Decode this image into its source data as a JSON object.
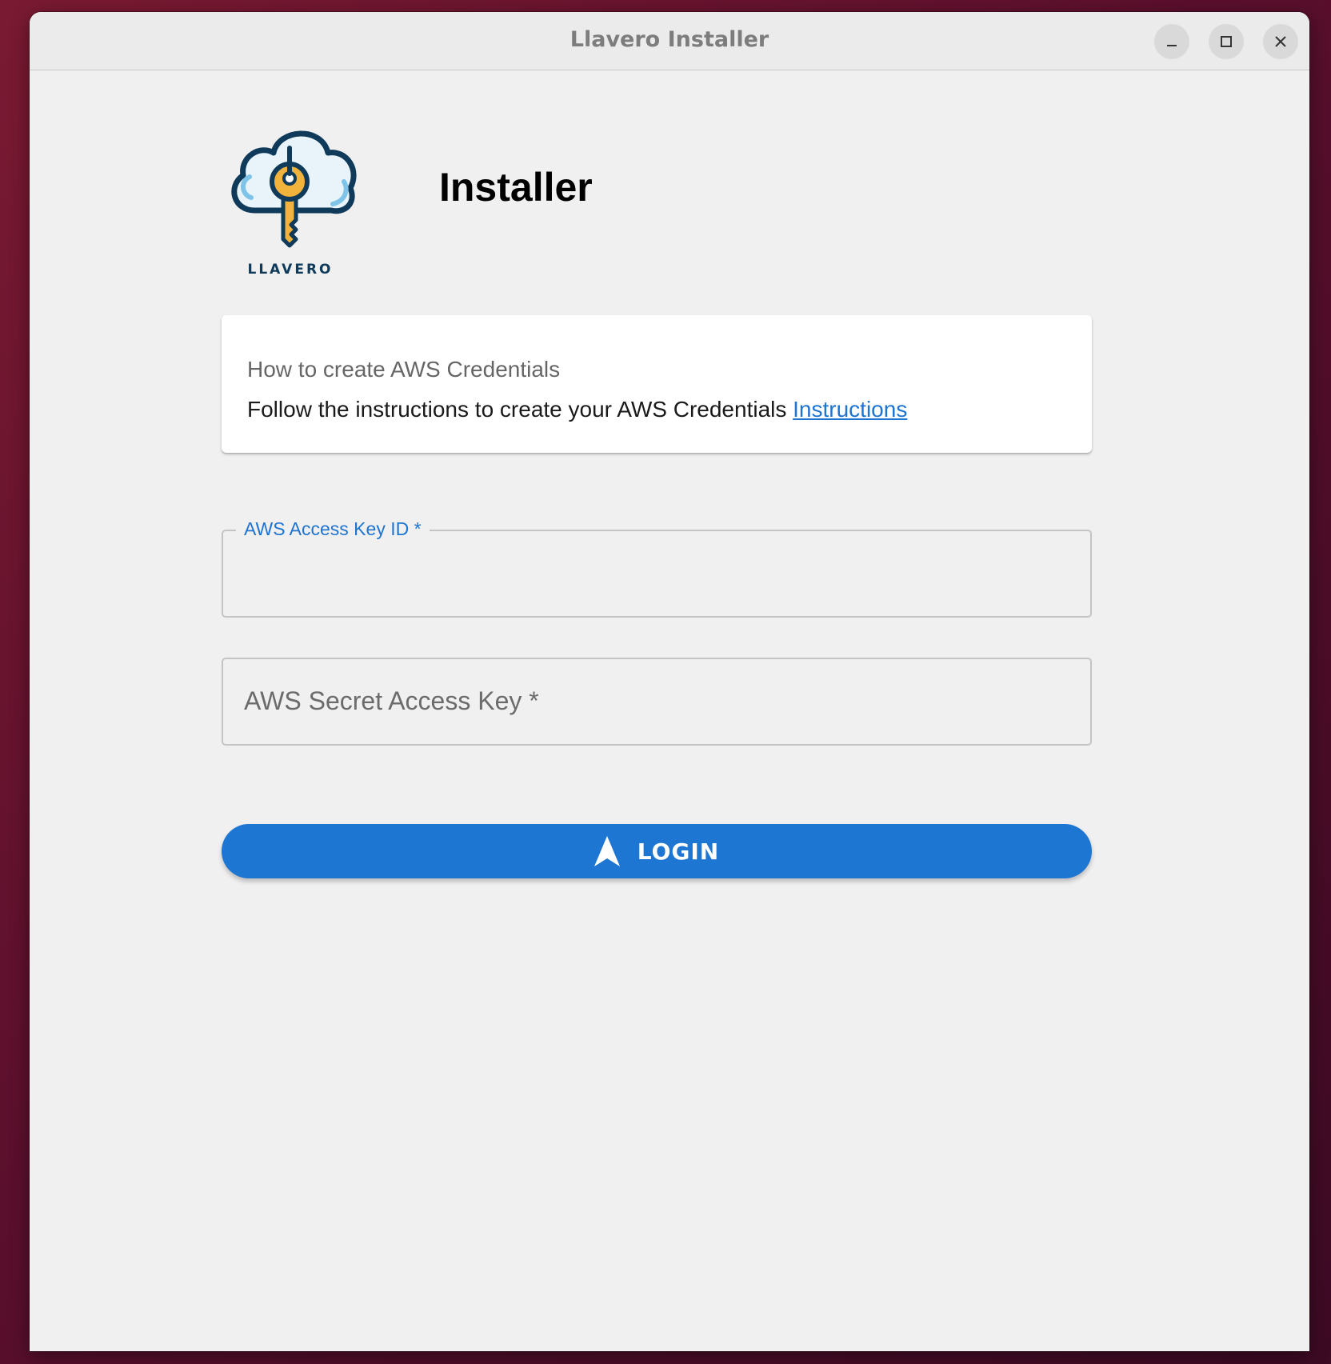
{
  "window": {
    "title": "Llavero Installer",
    "controls": [
      "minimize",
      "maximize",
      "close"
    ]
  },
  "header": {
    "logo_text": "LLAVERO",
    "title": "Installer"
  },
  "info_card": {
    "title": "How to create AWS Credentials",
    "body": "Follow the instructions to create your AWS Credentials",
    "link_label": "Instructions"
  },
  "form": {
    "access_key": {
      "label": "AWS Access Key ID *",
      "value": ""
    },
    "secret_key": {
      "label": "AWS Secret Access Key *",
      "value": ""
    }
  },
  "login_button": {
    "label": "LOGIN",
    "icon": "navigation-arrow-icon"
  },
  "colors": {
    "primary": "#1e76d3",
    "link": "#1e74d2",
    "window_bg": "#f0f0f0",
    "desktop_bg": "#5a0f2c",
    "logo_dark": "#0f3a5a",
    "logo_key": "#f2b33d"
  }
}
